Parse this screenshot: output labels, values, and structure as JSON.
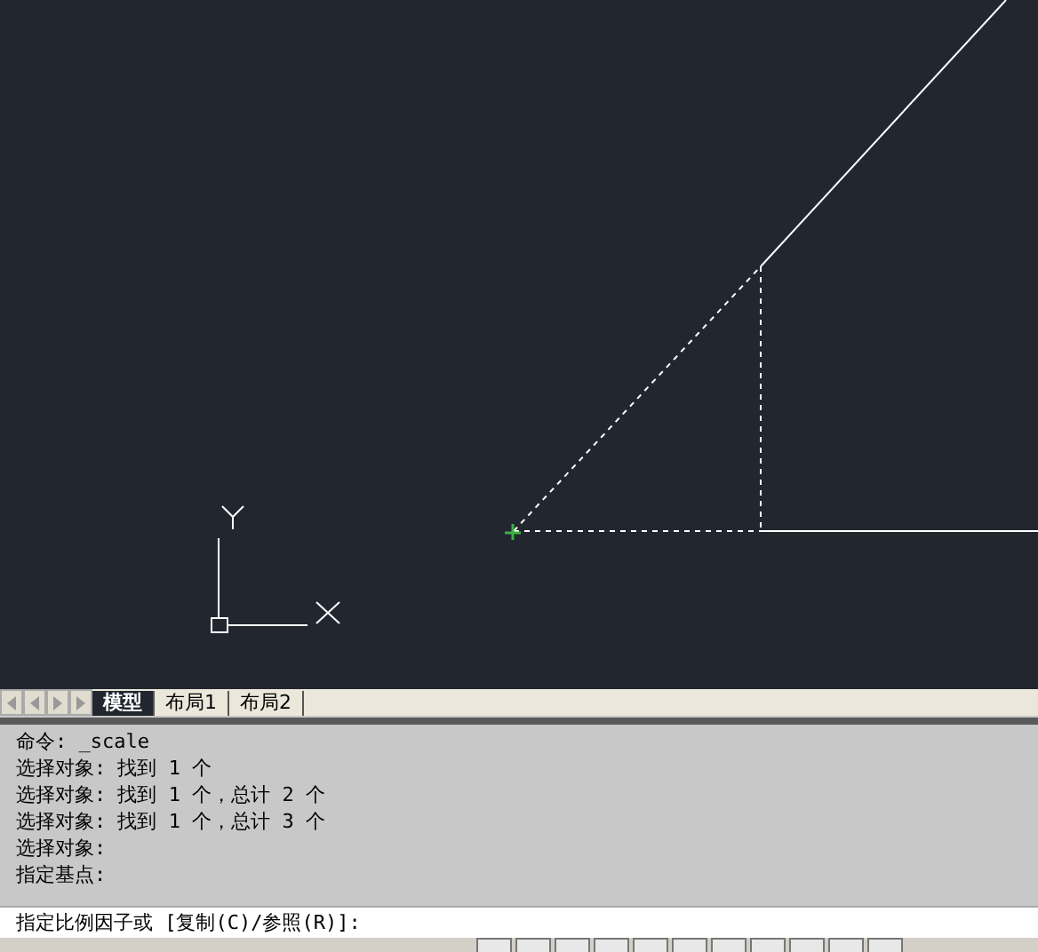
{
  "layout_tabs": [
    {
      "label": "模型",
      "selected": true
    },
    {
      "label": "布局1",
      "selected": false
    },
    {
      "label": "布局2",
      "selected": false
    }
  ],
  "command_history": [
    "命令: _scale",
    "选择对象: 找到 1 个",
    "选择对象: 找到 1 个，总计 2 个",
    "选择对象: 找到 1 个，总计 3 个",
    "选择对象:",
    "指定基点:"
  ],
  "command_prompt": "指定比例因子或 [复制(C)/参照(R)]:"
}
